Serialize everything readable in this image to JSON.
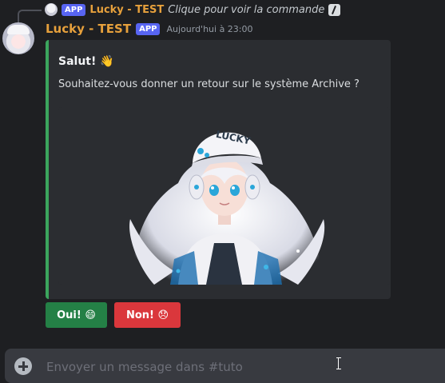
{
  "reply": {
    "badge": "APP",
    "name": "Lucky - TEST",
    "text": "Clique pour voir la commande",
    "icon": "slash-command-icon"
  },
  "message": {
    "username": "Lucky - TEST",
    "badge": "APP",
    "timestamp": "Aujourd'hui à 23:00",
    "accent_color": "#e6a03c",
    "avatar_icon": "bot-avatar"
  },
  "embed": {
    "title": "Salut! 👋",
    "description": "Souhaitez-vous donner un retour sur le système Archive ?",
    "border_color": "#3ba55d",
    "image_icon": "anime-girl-lucky-cap-image",
    "image_cap_text": "LUCKY"
  },
  "buttons": {
    "yes_label": "Oui! 😄",
    "no_label": "Non! 😞",
    "yes_color": "#248046",
    "no_color": "#da373c"
  },
  "composer": {
    "placeholder": "Envoyer un message dans #tuto",
    "plus_icon": "plus-circle-icon"
  }
}
